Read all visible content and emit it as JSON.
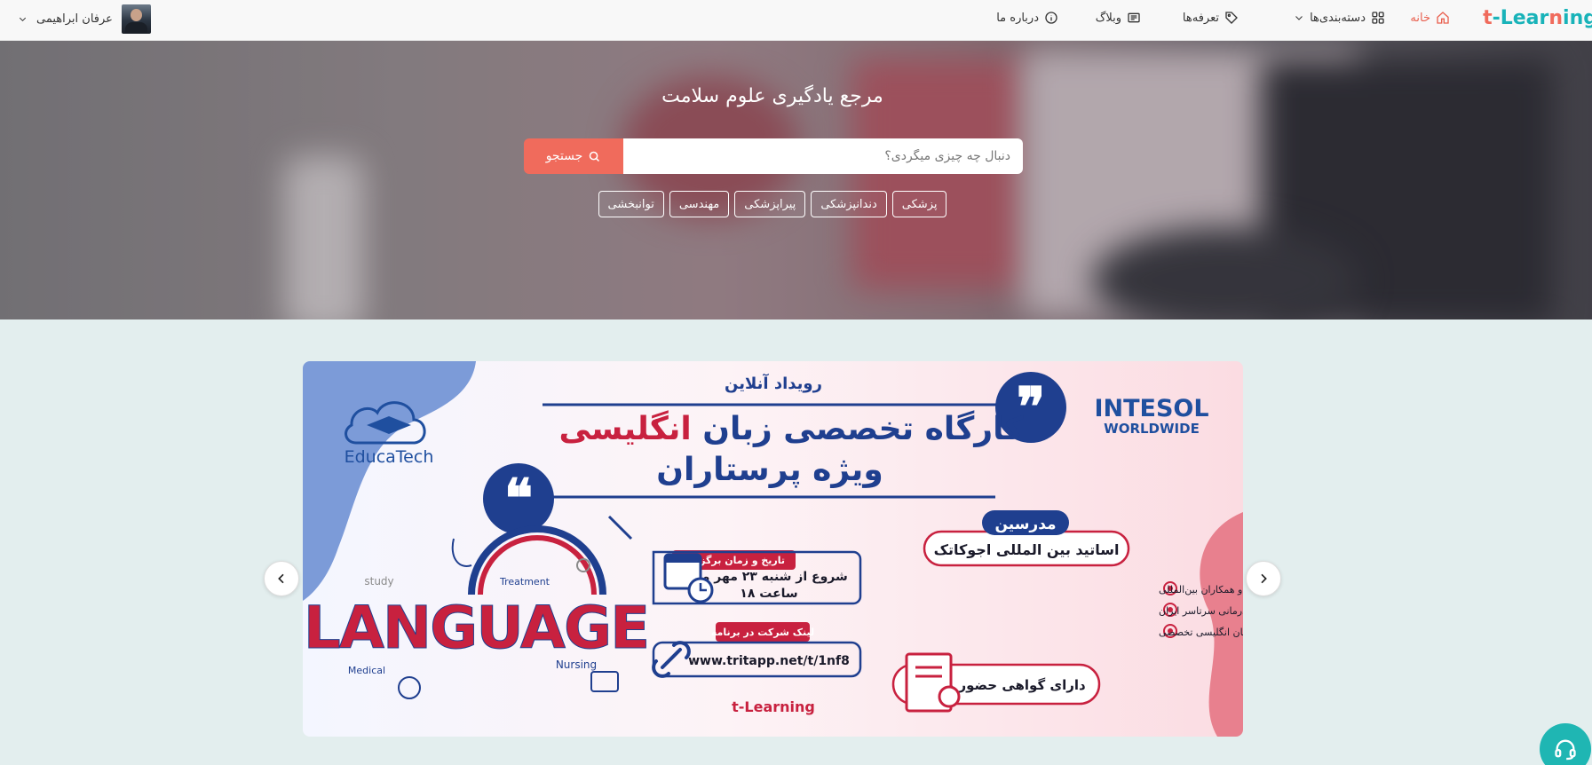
{
  "navbar": {
    "logo_t": "t",
    "logo_dash": "-Lear",
    "logo_n": "n",
    "logo_rest": "ing",
    "home": "خانه",
    "categories": "دسته‌بندی‌ها",
    "pricing": "تعرفه‌ها",
    "blog": "وبلاگ",
    "about": "درباره ما",
    "user_name": "عرفان ابراهیمی"
  },
  "hero": {
    "title": "مرجع یادگیری علوم سلامت",
    "search_placeholder": "دنبال چه چیزی میگردی؟",
    "search_button": "جستجو",
    "tags": [
      "پزشکی",
      "دندانپزشکی",
      "پیراپزشکی",
      "مهندسی",
      "توانبخشی"
    ]
  },
  "banner": {
    "event_label": "رویداد آنلاین",
    "title_line1_a": "کارگاه تخصصی زبان ",
    "title_line1_b": "انگلیسی",
    "title_line2": "ویژه پرستاران",
    "org": "INTESOL",
    "org_sub": "WORLDWIDE",
    "educatech": "EducaTech",
    "teachers_label": "مدرسین",
    "teachers": "اساتید بین المللی اجوکاتک",
    "benefits": [
      "توانایی پزشکان در ایجاد ارتباط با بیماران و همکاران بین‌المللی",
      "امکان ایجاد کار در بخش‌های بین المللی مراکز درمانی سرتاسر ایران",
      "کمک به ارتقای سطح تسلط به زبان انگلیسی تخصصی"
    ],
    "certificate": "دارای گواهی حضور دیجیتال",
    "date_label": "تاریخ و زمان برگزاری",
    "date_line1": "شروع از شنبه ۲۳ مهر ماه",
    "date_line2": "ساعت ۱۸",
    "link_label": "لینک شرکت در برنامه",
    "link": "www.tritapp.net/t/1nf8",
    "word_language": "LANGUAGE",
    "word_treatment": "Treatment",
    "word_study": "study",
    "word_medical": "Medical",
    "word_nursing": "Nursing",
    "footer_logo": "t-Learning"
  },
  "colors": {
    "accent": "#f06b5c",
    "teal": "#19b3b9",
    "navy": "#1f3f8f",
    "crimson": "#c8213f"
  }
}
